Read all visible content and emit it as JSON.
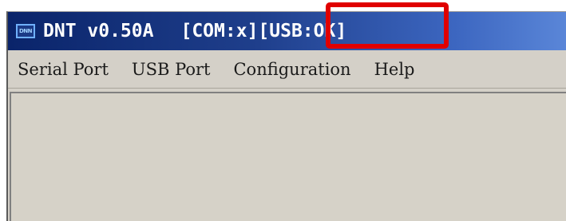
{
  "window": {
    "title": "DNT v0.50A",
    "com_status": "[COM:x]",
    "usb_status": "[USB:OK]",
    "icon_label": "DNN"
  },
  "menu": {
    "items": [
      {
        "label": "Serial Port"
      },
      {
        "label": "USB Port"
      },
      {
        "label": "Configuration"
      },
      {
        "label": "Help"
      }
    ]
  },
  "colors": {
    "titlebar_start": "#0a246a",
    "titlebar_end": "#5a86d8",
    "highlight": "#e00000",
    "window_bg": "#d4d0c8"
  }
}
